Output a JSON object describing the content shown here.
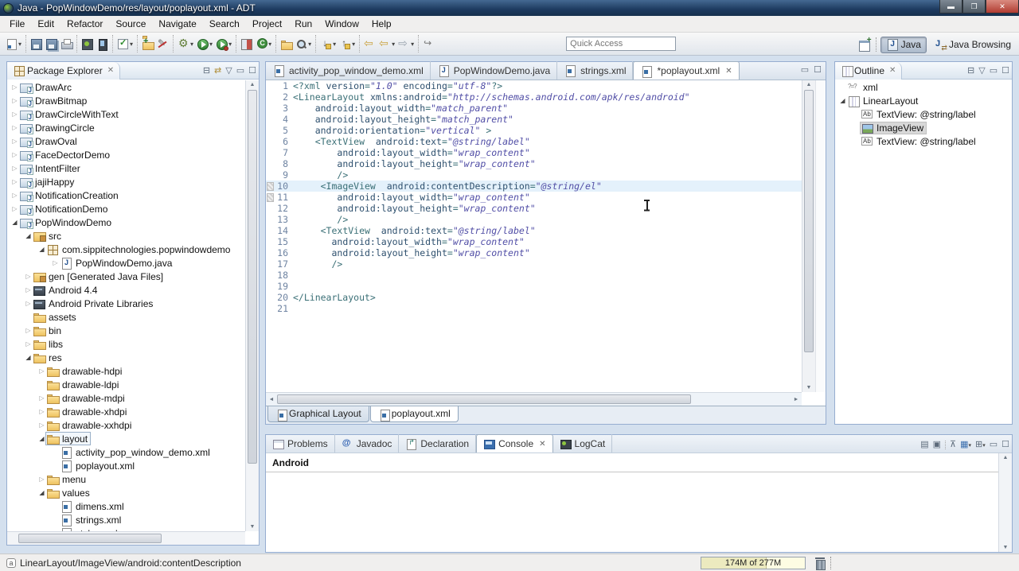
{
  "window": {
    "title": "Java - PopWindowDemo/res/layout/poplayout.xml - ADT"
  },
  "menu": [
    "File",
    "Edit",
    "Refactor",
    "Source",
    "Navigate",
    "Search",
    "Project",
    "Run",
    "Window",
    "Help"
  ],
  "toolbar": {
    "quick_access": {
      "placeholder": "Quick Access"
    },
    "groups": [
      [
        {
          "name": "new-wizard",
          "icon": "doc blue",
          "dd": true
        }
      ],
      [
        {
          "name": "save",
          "icon": "floppy"
        },
        {
          "name": "save-all",
          "icon": "floppy multi"
        },
        {
          "name": "print",
          "icon": "printer"
        }
      ],
      [
        {
          "name": "android-sdk-manager",
          "icon": "droidbox"
        },
        {
          "name": "android-virtual-device-manager",
          "icon": "device"
        }
      ],
      [
        {
          "name": "verify-apk",
          "icon": "checkb",
          "dd": true
        }
      ],
      [
        {
          "name": "new-android-project",
          "icon": "folder-y folder-plus"
        },
        {
          "name": "run-lint",
          "icon": "pencil"
        }
      ],
      [
        {
          "name": "debug",
          "icon": "gearbug",
          "dd": true
        },
        {
          "name": "run",
          "icon": "playg",
          "dd": true
        },
        {
          "name": "run-external-tools",
          "icon": "playg playdot",
          "dd": true
        }
      ],
      [
        {
          "name": "coverage",
          "icon": "covgrid"
        },
        {
          "name": "new-java-class",
          "icon": "classC",
          "dd": true
        }
      ],
      [
        {
          "name": "open-resource",
          "icon": "folder-y"
        },
        {
          "name": "search",
          "icon": "mag",
          "dd": true
        }
      ],
      [
        {
          "name": "next-annotation",
          "icon": "annext",
          "dd": true
        },
        {
          "name": "previous-annotation",
          "icon": "annprev",
          "dd": true
        }
      ],
      [
        {
          "name": "back",
          "icon": "navback"
        },
        {
          "name": "back-history",
          "icon": "navback",
          "dd": true
        },
        {
          "name": "forward",
          "icon": "navfwd",
          "dd": true
        }
      ],
      [
        {
          "name": "last-edit-location",
          "icon": "editloc"
        }
      ]
    ],
    "perspectives": {
      "items": [
        {
          "label": "Java",
          "active": true,
          "icon": "jpersp"
        },
        {
          "label": "Java Browsing",
          "active": false,
          "icon": "jbpersp"
        }
      ]
    }
  },
  "package_explorer": {
    "title": "Package Explorer",
    "toolbar": [
      "collapse-all",
      "link-with-editor",
      "view-menu",
      "minimize",
      "maximize"
    ],
    "tree": [
      {
        "d": 0,
        "a": "c",
        "i": "fi-proj",
        "label": "DrawArc"
      },
      {
        "d": 0,
        "a": "c",
        "i": "fi-proj",
        "label": "DrawBitmap"
      },
      {
        "d": 0,
        "a": "c",
        "i": "fi-proj",
        "label": "DrawCircleWithText"
      },
      {
        "d": 0,
        "a": "c",
        "i": "fi-proj",
        "label": "DrawingCircle"
      },
      {
        "d": 0,
        "a": "c",
        "i": "fi-proj",
        "label": "DrawOval"
      },
      {
        "d": 0,
        "a": "c",
        "i": "fi-proj",
        "label": "FaceDectorDemo"
      },
      {
        "d": 0,
        "a": "c",
        "i": "fi-proj",
        "label": "IntentFilter"
      },
      {
        "d": 0,
        "a": "c",
        "i": "fi-proj",
        "label": "jajiHappy"
      },
      {
        "d": 0,
        "a": "c",
        "i": "fi-proj",
        "label": "NotificationCreation"
      },
      {
        "d": 0,
        "a": "c",
        "i": "fi-proj",
        "label": "NotificationDemo"
      },
      {
        "d": 0,
        "a": "e",
        "i": "fi-proj",
        "label": "PopWindowDemo"
      },
      {
        "d": 1,
        "a": "e",
        "i": "fi-src",
        "label": "src"
      },
      {
        "d": 2,
        "a": "e",
        "i": "fi-pkg",
        "label": "com.sippitechnologies.popwindowdemo"
      },
      {
        "d": 3,
        "a": "c",
        "i": "fi-java",
        "label": "PopWindowDemo.java"
      },
      {
        "d": 1,
        "a": "c",
        "i": "fi-src",
        "label": "gen [Generated Java Files]"
      },
      {
        "d": 1,
        "a": "c",
        "i": "fi-lib",
        "label": "Android 4.4"
      },
      {
        "d": 1,
        "a": "c",
        "i": "fi-lib",
        "label": "Android Private Libraries"
      },
      {
        "d": 1,
        "a": "n",
        "i": "fi-folder",
        "label": "assets"
      },
      {
        "d": 1,
        "a": "c",
        "i": "fi-folder",
        "label": "bin"
      },
      {
        "d": 1,
        "a": "c",
        "i": "fi-folder",
        "label": "libs"
      },
      {
        "d": 1,
        "a": "e",
        "i": "fi-folder",
        "label": "res"
      },
      {
        "d": 2,
        "a": "c",
        "i": "fi-folder",
        "label": "drawable-hdpi"
      },
      {
        "d": 2,
        "a": "n",
        "i": "fi-folder",
        "label": "drawable-ldpi"
      },
      {
        "d": 2,
        "a": "c",
        "i": "fi-folder",
        "label": "drawable-mdpi"
      },
      {
        "d": 2,
        "a": "c",
        "i": "fi-folder",
        "label": "drawable-xhdpi"
      },
      {
        "d": 2,
        "a": "c",
        "i": "fi-folder",
        "label": "drawable-xxhdpi"
      },
      {
        "d": 2,
        "a": "e",
        "i": "fi-folder",
        "label": "layout",
        "focused": true
      },
      {
        "d": 3,
        "a": "n",
        "i": "fi-xml",
        "label": "activity_pop_window_demo.xml"
      },
      {
        "d": 3,
        "a": "n",
        "i": "fi-xml",
        "label": "poplayout.xml"
      },
      {
        "d": 2,
        "a": "c",
        "i": "fi-folder",
        "label": "menu"
      },
      {
        "d": 2,
        "a": "e",
        "i": "fi-folder",
        "label": "values"
      },
      {
        "d": 3,
        "a": "n",
        "i": "fi-xml",
        "label": "dimens.xml"
      },
      {
        "d": 3,
        "a": "n",
        "i": "fi-xml",
        "label": "strings.xml"
      },
      {
        "d": 3,
        "a": "n",
        "i": "fi-xml",
        "label": "styles.xml"
      }
    ]
  },
  "editor": {
    "tabs": [
      {
        "label": "activity_pop_window_demo.xml",
        "icon": "fi-xml",
        "active": false
      },
      {
        "label": "PopWindowDemo.java",
        "icon": "fi-java",
        "active": false
      },
      {
        "label": "strings.xml",
        "icon": "fi-xml",
        "active": false
      },
      {
        "label": "*poplayout.xml",
        "icon": "fi-xml",
        "active": true,
        "closable": true
      }
    ],
    "bottom_tabs": [
      {
        "label": "Graphical Layout",
        "active": false
      },
      {
        "label": "poplayout.xml",
        "active": true
      }
    ],
    "code": {
      "current_line": 10,
      "marker_lines": [
        10,
        11
      ],
      "lines": [
        {
          "n": 1,
          "toks": [
            [
              "t",
              "<?xml "
            ],
            [
              "a",
              "version"
            ],
            [
              "t",
              "="
            ],
            [
              "v",
              "\"1.0\""
            ],
            [
              "p",
              " "
            ],
            [
              "a",
              "encoding"
            ],
            [
              "t",
              "="
            ],
            [
              "v",
              "\"utf-8\""
            ],
            [
              "t",
              "?>"
            ]
          ]
        },
        {
          "n": 2,
          "toks": [
            [
              "t",
              "<LinearLayout "
            ],
            [
              "a",
              "xmlns:android"
            ],
            [
              "t",
              "="
            ],
            [
              "v",
              "\"http://schemas.android.com/apk/res/android\""
            ]
          ]
        },
        {
          "n": 3,
          "toks": [
            [
              "p",
              "    "
            ],
            [
              "a",
              "android:layout_width"
            ],
            [
              "t",
              "="
            ],
            [
              "v",
              "\"match_parent\""
            ]
          ]
        },
        {
          "n": 4,
          "toks": [
            [
              "p",
              "    "
            ],
            [
              "a",
              "android:layout_height"
            ],
            [
              "t",
              "="
            ],
            [
              "v",
              "\"match_parent\""
            ]
          ]
        },
        {
          "n": 5,
          "toks": [
            [
              "p",
              "    "
            ],
            [
              "a",
              "android:orientation"
            ],
            [
              "t",
              "="
            ],
            [
              "v",
              "\"vertical\""
            ],
            [
              "t",
              " >"
            ]
          ]
        },
        {
          "n": 6,
          "toks": [
            [
              "p",
              "    "
            ],
            [
              "t",
              "<TextView  "
            ],
            [
              "a",
              "android:text"
            ],
            [
              "t",
              "="
            ],
            [
              "v",
              "\"@string/label\""
            ]
          ]
        },
        {
          "n": 7,
          "toks": [
            [
              "p",
              "        "
            ],
            [
              "a",
              "android:layout_width"
            ],
            [
              "t",
              "="
            ],
            [
              "v",
              "\"wrap_content\""
            ]
          ]
        },
        {
          "n": 8,
          "toks": [
            [
              "p",
              "        "
            ],
            [
              "a",
              "android:layout_height"
            ],
            [
              "t",
              "="
            ],
            [
              "v",
              "\"wrap_content\""
            ]
          ]
        },
        {
          "n": 9,
          "toks": [
            [
              "p",
              "        "
            ],
            [
              "t",
              "/>"
            ]
          ]
        },
        {
          "n": 10,
          "toks": [
            [
              "p",
              "     "
            ],
            [
              "t",
              "<ImageView  "
            ],
            [
              "a",
              "android:contentDescription"
            ],
            [
              "t",
              "="
            ],
            [
              "v",
              "\"@string/el\""
            ]
          ]
        },
        {
          "n": 11,
          "toks": [
            [
              "p",
              "        "
            ],
            [
              "a",
              "android:layout_width"
            ],
            [
              "t",
              "="
            ],
            [
              "v",
              "\"wrap_content\""
            ]
          ]
        },
        {
          "n": 12,
          "toks": [
            [
              "p",
              "        "
            ],
            [
              "a",
              "android:layout_height"
            ],
            [
              "t",
              "="
            ],
            [
              "v",
              "\"wrap_content\""
            ]
          ]
        },
        {
          "n": 13,
          "toks": [
            [
              "p",
              "        "
            ],
            [
              "t",
              "/>"
            ]
          ]
        },
        {
          "n": 14,
          "toks": [
            [
              "p",
              "     "
            ],
            [
              "t",
              "<TextView  "
            ],
            [
              "a",
              "android:text"
            ],
            [
              "t",
              "="
            ],
            [
              "v",
              "\"@string/label\""
            ]
          ]
        },
        {
          "n": 15,
          "toks": [
            [
              "p",
              "       "
            ],
            [
              "a",
              "android:layout_width"
            ],
            [
              "t",
              "="
            ],
            [
              "v",
              "\"wrap_content\""
            ]
          ]
        },
        {
          "n": 16,
          "toks": [
            [
              "p",
              "       "
            ],
            [
              "a",
              "android:layout_height"
            ],
            [
              "t",
              "="
            ],
            [
              "v",
              "\"wrap_content\""
            ]
          ]
        },
        {
          "n": 17,
          "toks": [
            [
              "p",
              "       "
            ],
            [
              "t",
              "/>"
            ]
          ]
        },
        {
          "n": 18,
          "toks": []
        },
        {
          "n": 19,
          "toks": []
        },
        {
          "n": 20,
          "toks": [
            [
              "t",
              "</LinearLayout>"
            ]
          ]
        },
        {
          "n": 21,
          "toks": []
        }
      ]
    }
  },
  "outline": {
    "title": "Outline",
    "toolbar": [
      "collapse-all",
      "view-menu",
      "minimize",
      "maximize"
    ],
    "tree": [
      {
        "d": 0,
        "a": "n",
        "i": "oi-xml",
        "label": "xml"
      },
      {
        "d": 0,
        "a": "e",
        "i": "oi-lin",
        "label": "LinearLayout"
      },
      {
        "d": 1,
        "a": "n",
        "i": "oi-ab",
        "label": "TextView: @string/label"
      },
      {
        "d": 1,
        "a": "n",
        "i": "oi-img",
        "label": "ImageView",
        "selected": true
      },
      {
        "d": 1,
        "a": "n",
        "i": "oi-ab",
        "label": "TextView: @string/label"
      }
    ]
  },
  "console": {
    "tabs": [
      {
        "label": "Problems",
        "icon": "ci-problems",
        "active": false
      },
      {
        "label": "Javadoc",
        "icon": "ci-javadoc",
        "active": false
      },
      {
        "label": "Declaration",
        "icon": "ci-decl",
        "active": false
      },
      {
        "label": "Console",
        "icon": "ci-console",
        "active": true,
        "closable": true
      },
      {
        "label": "LogCat",
        "icon": "ci-logcat",
        "active": false
      }
    ],
    "toolbar": [
      "clear-console",
      "scroll-lock",
      "pin-console",
      "display-selected-console",
      "open-console",
      "minimize",
      "maximize"
    ],
    "header": "Android"
  },
  "status_bar": {
    "selection_path": "LinearLayout/ImageView/android:contentDescription",
    "heap": {
      "text": "174M of 277M",
      "used_fraction": 0.63
    }
  },
  "colors": {
    "accent_selection": "#e4f1fb",
    "tag": "#3a6f76",
    "attribute": "#2e506e",
    "value": "#514ea6"
  }
}
